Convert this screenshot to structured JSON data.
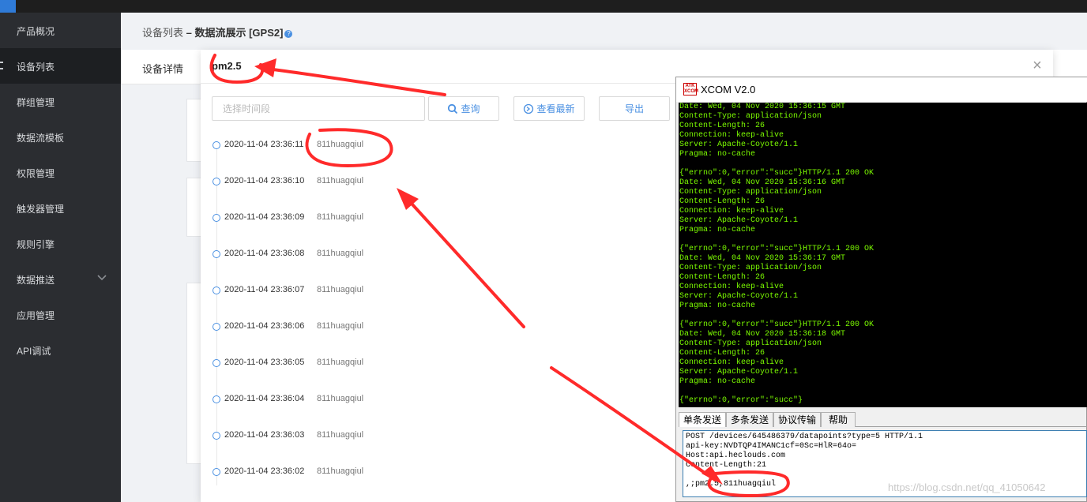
{
  "sidebar": {
    "items": [
      {
        "label": "产品概况",
        "active": false
      },
      {
        "label": "设备列表",
        "active": true
      },
      {
        "label": "群组管理",
        "active": false
      },
      {
        "label": "数据流模板",
        "active": false
      },
      {
        "label": "权限管理",
        "active": false
      },
      {
        "label": "触发器管理",
        "active": false
      },
      {
        "label": "规则引擎",
        "active": false
      },
      {
        "label": "数据推送",
        "active": false,
        "expandable": true
      },
      {
        "label": "应用管理",
        "active": false
      },
      {
        "label": "API调试",
        "active": false
      }
    ]
  },
  "breadcrumb": {
    "parent": "设备列表",
    "separator": " – ",
    "current": "数据流展示 [GPS2]",
    "help": "?"
  },
  "detail_tab": {
    "label": "设备详情"
  },
  "modal": {
    "title": "pm2.5",
    "close": "×",
    "time_placeholder": "选择时间段",
    "query_label": "查询",
    "latest_label": "查看最新",
    "export_label": "导出",
    "records": [
      {
        "time": "2020-11-04 23:36:11",
        "value": "811huagqiul"
      },
      {
        "time": "2020-11-04 23:36:10",
        "value": "811huagqiul"
      },
      {
        "time": "2020-11-04 23:36:09",
        "value": "811huagqiul"
      },
      {
        "time": "2020-11-04 23:36:08",
        "value": "811huagqiul"
      },
      {
        "time": "2020-11-04 23:36:07",
        "value": "811huagqiul"
      },
      {
        "time": "2020-11-04 23:36:06",
        "value": "811huagqiul"
      },
      {
        "time": "2020-11-04 23:36:05",
        "value": "811huagqiul"
      },
      {
        "time": "2020-11-04 23:36:04",
        "value": "811huagqiul"
      },
      {
        "time": "2020-11-04 23:36:03",
        "value": "811huagqiul"
      },
      {
        "time": "2020-11-04 23:36:02",
        "value": "811huagqiul"
      }
    ]
  },
  "xcom": {
    "logo": "ATK XCOM",
    "title": "XCOM V2.0",
    "receive_text": "Date: Wed, 04 Nov 2020 15:36:15 GMT\nContent-Type: application/json\nContent-Length: 26\nConnection: keep-alive\nServer: Apache-Coyote/1.1\nPragma: no-cache\n\n{\"errno\":0,\"error\":\"succ\"}HTTP/1.1 200 OK\nDate: Wed, 04 Nov 2020 15:36:16 GMT\nContent-Type: application/json\nContent-Length: 26\nConnection: keep-alive\nServer: Apache-Coyote/1.1\nPragma: no-cache\n\n{\"errno\":0,\"error\":\"succ\"}HTTP/1.1 200 OK\nDate: Wed, 04 Nov 2020 15:36:17 GMT\nContent-Type: application/json\nContent-Length: 26\nConnection: keep-alive\nServer: Apache-Coyote/1.1\nPragma: no-cache\n\n{\"errno\":0,\"error\":\"succ\"}HTTP/1.1 200 OK\nDate: Wed, 04 Nov 2020 15:36:18 GMT\nContent-Type: application/json\nContent-Length: 26\nConnection: keep-alive\nServer: Apache-Coyote/1.1\nPragma: no-cache\n\n{\"errno\":0,\"error\":\"succ\"}",
    "tabs": [
      "单条发送",
      "多条发送",
      "协议传输",
      "帮助"
    ],
    "send_text": "POST /devices/645486379/datapoints?type=5 HTTP/1.1\napi-key:NVDTQP4IMANC1cf=0Sc=HlR=64o=\nHost:api.heclouds.com\nContent-Length:21\n\n,;pm2.5,811huagqiul"
  },
  "watermark": "https://blog.csdn.net/qq_41050642",
  "colors": {
    "sidebar_bg": "#2b2d31",
    "accent": "#4a90e2",
    "terminal_text": "#7cfc00",
    "annotation": "#ff2a2a"
  }
}
